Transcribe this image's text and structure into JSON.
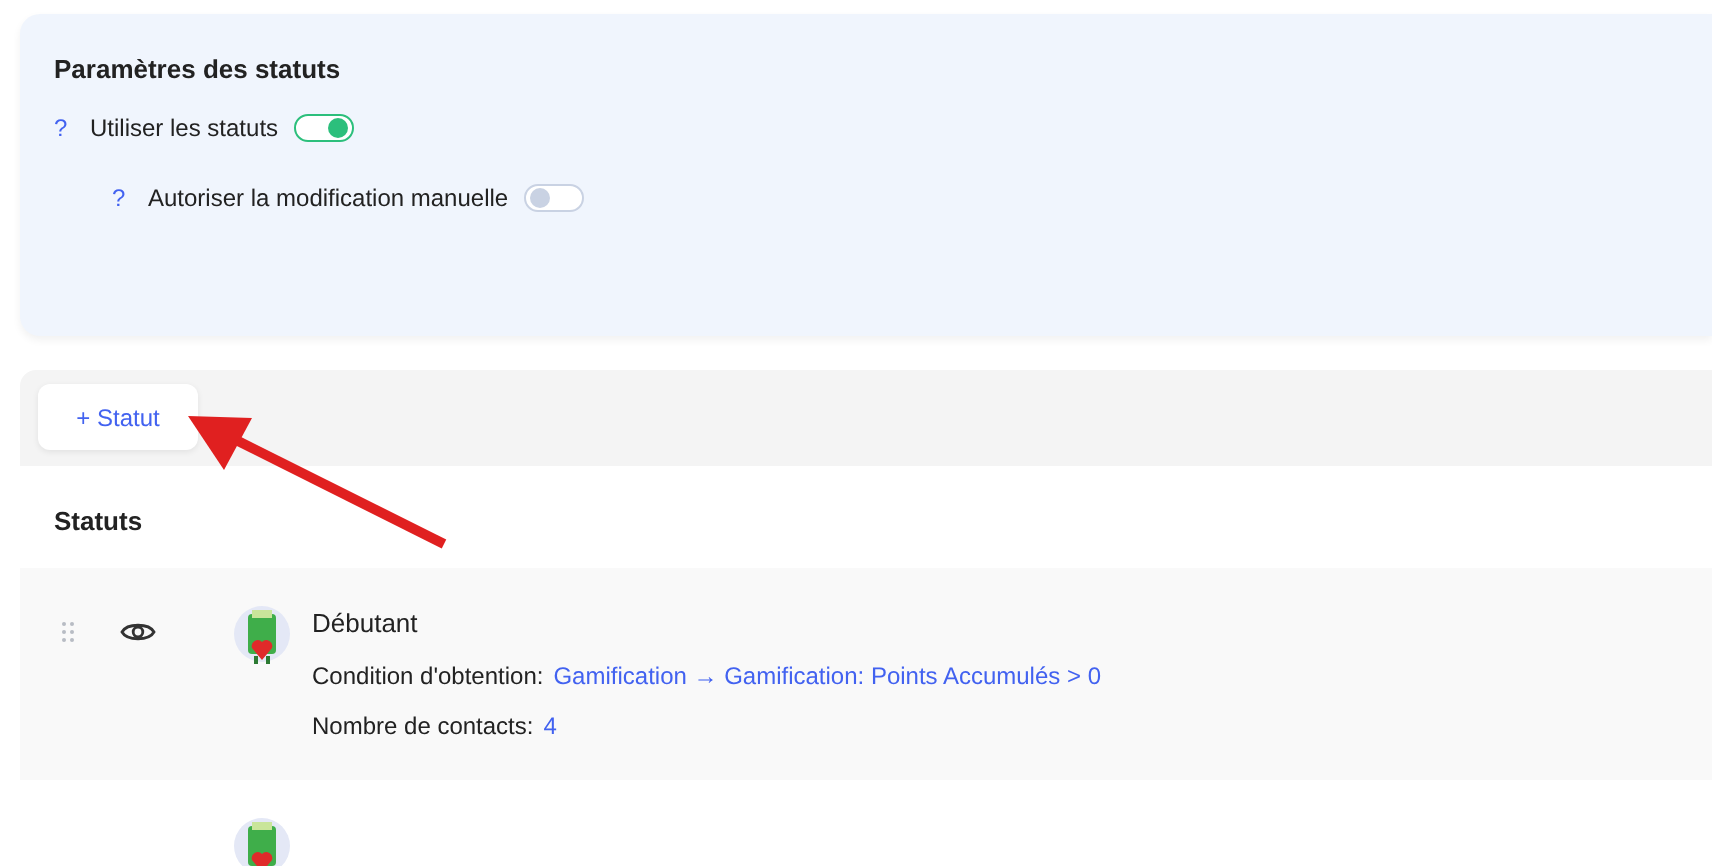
{
  "settings": {
    "title": "Paramètres des statuts",
    "options": [
      {
        "help": "?",
        "label": "Utiliser les statuts",
        "on": true,
        "children": [
          {
            "help": "?",
            "label": "Autoriser la modification manuelle",
            "on": false
          }
        ]
      }
    ]
  },
  "add_button": "+ Statut",
  "statuses": {
    "title": "Statuts",
    "items": [
      {
        "kind": "full",
        "name": "Débutant",
        "condition_label": "Condition d'obtention:",
        "condition": "Gamification → Gamification: Points Accumulés > 0",
        "contacts_label": "Nombre de contacts:",
        "contacts": "4"
      },
      {
        "kind": "partial"
      }
    ]
  }
}
